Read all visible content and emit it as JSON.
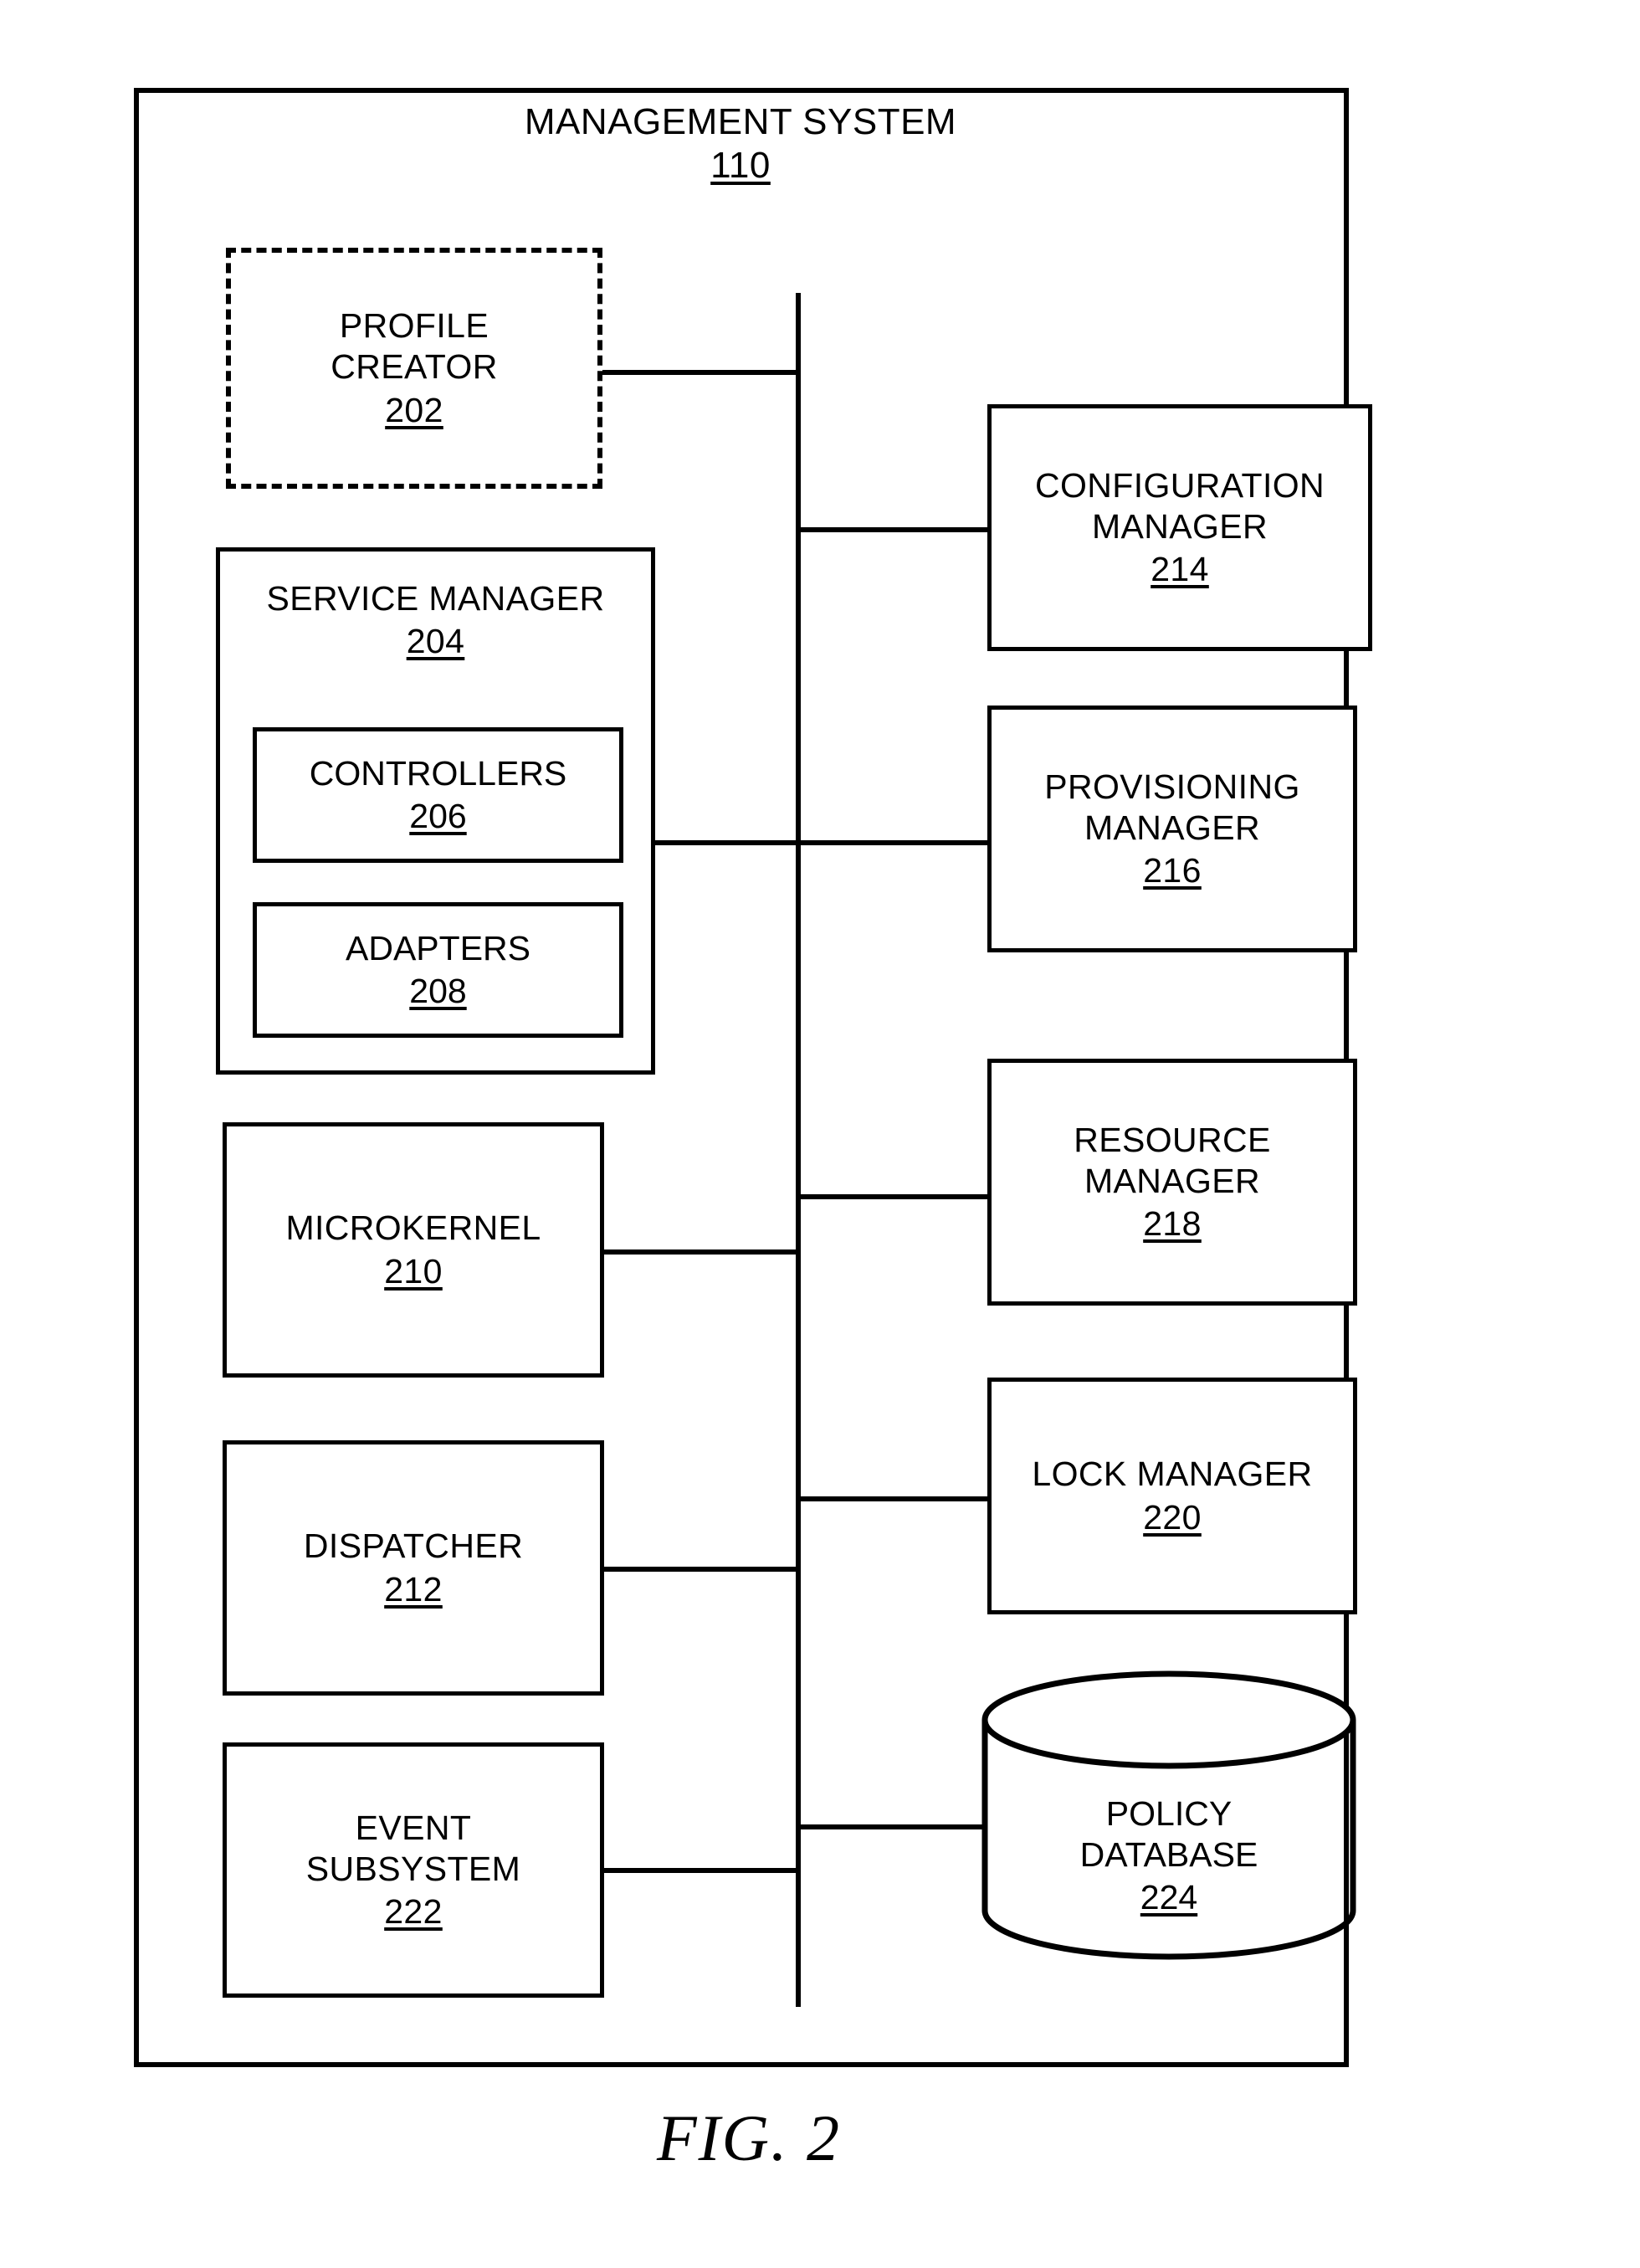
{
  "figure": {
    "caption": "FIG. 2",
    "title": "MANAGEMENT SYSTEM",
    "title_ref": "110"
  },
  "nodes": {
    "profile_creator": {
      "label": "PROFILE\nCREATOR",
      "ref": "202",
      "style": "dashed"
    },
    "service_manager": {
      "label": "SERVICE MANAGER",
      "ref": "204",
      "style": "solid"
    },
    "controllers": {
      "label": "CONTROLLERS",
      "ref": "206",
      "style": "solid"
    },
    "adapters": {
      "label": "ADAPTERS",
      "ref": "208",
      "style": "solid"
    },
    "microkernel": {
      "label": "MICROKERNEL",
      "ref": "210",
      "style": "solid"
    },
    "dispatcher": {
      "label": "DISPATCHER",
      "ref": "212",
      "style": "solid"
    },
    "event_subsystem": {
      "label": "EVENT\nSUBSYSTEM",
      "ref": "222",
      "style": "solid"
    },
    "configuration_manager": {
      "label": "CONFIGURATION\nMANAGER",
      "ref": "214",
      "style": "solid"
    },
    "provisioning_manager": {
      "label": "PROVISIONING\nMANAGER",
      "ref": "216",
      "style": "solid"
    },
    "resource_manager": {
      "label": "RESOURCE\nMANAGER",
      "ref": "218",
      "style": "solid"
    },
    "lock_manager": {
      "label": "LOCK MANAGER",
      "ref": "220",
      "style": "solid"
    },
    "policy_database": {
      "label": "POLICY\nDATABASE",
      "ref": "224",
      "style": "cylinder"
    }
  },
  "colors": {
    "stroke": "#000000",
    "background": "#ffffff"
  }
}
